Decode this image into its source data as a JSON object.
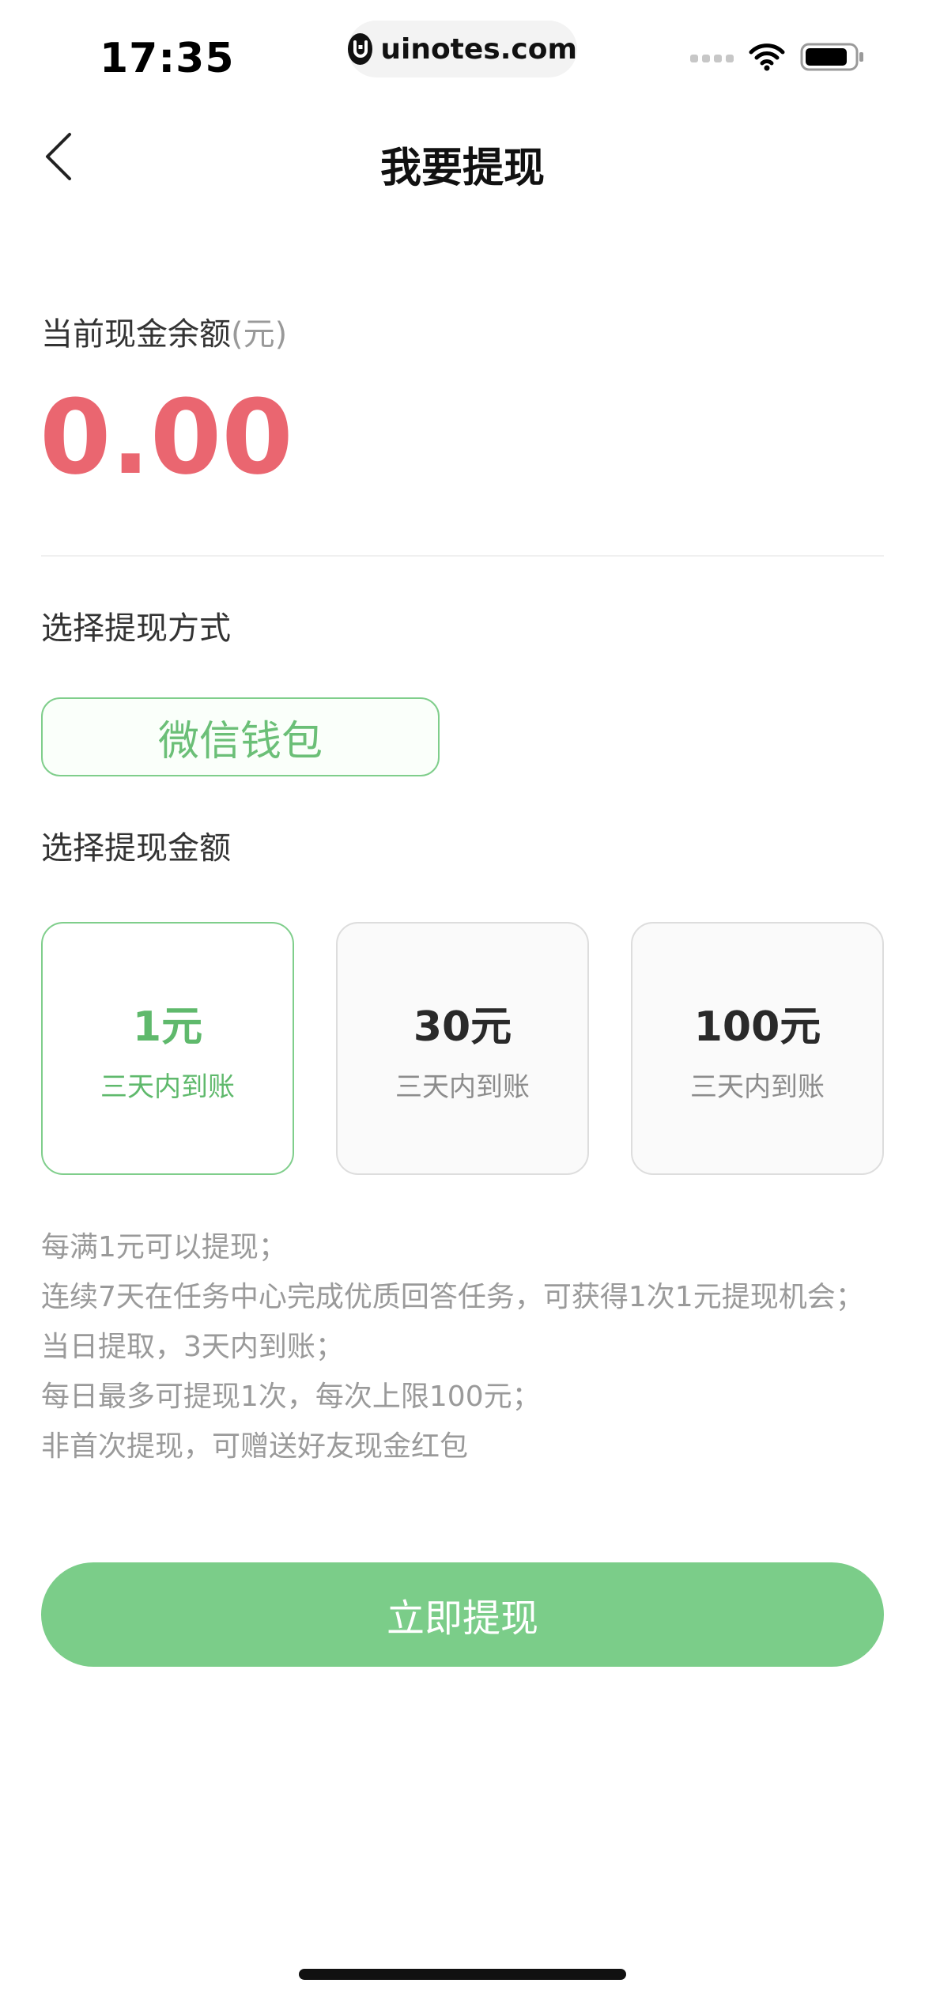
{
  "status_bar": {
    "time": "17:35",
    "url": "uinotes.com"
  },
  "nav": {
    "title": "我要提现"
  },
  "balance": {
    "label": "当前现金余额",
    "unit": "(元)",
    "value": "0.00"
  },
  "method": {
    "section_label": "选择提现方式",
    "option": "微信钱包"
  },
  "amount": {
    "section_label": "选择提现金额",
    "options": [
      {
        "value": "1元",
        "sub": "三天内到账",
        "selected": true
      },
      {
        "value": "30元",
        "sub": "三天内到账",
        "selected": false
      },
      {
        "value": "100元",
        "sub": "三天内到账",
        "selected": false
      }
    ]
  },
  "rules": [
    "每满1元可以提现；",
    "连续7天在任务中心完成优质回答任务，可获得1次1元提现机会；",
    "当日提取，3天内到账；",
    "每日最多可提现1次，每次上限100元；",
    "非首次提现，可赠送好友现金红包"
  ],
  "submit": {
    "label": "立即提现"
  },
  "colors": {
    "accent_green": "#7bcd89",
    "balance_red": "#ea6670"
  },
  "icons": {
    "back": "chevron-left-icon",
    "wifi": "wifi-icon",
    "battery": "battery-icon",
    "signal": "signal-icon",
    "site_logo": "site-logo-icon"
  }
}
